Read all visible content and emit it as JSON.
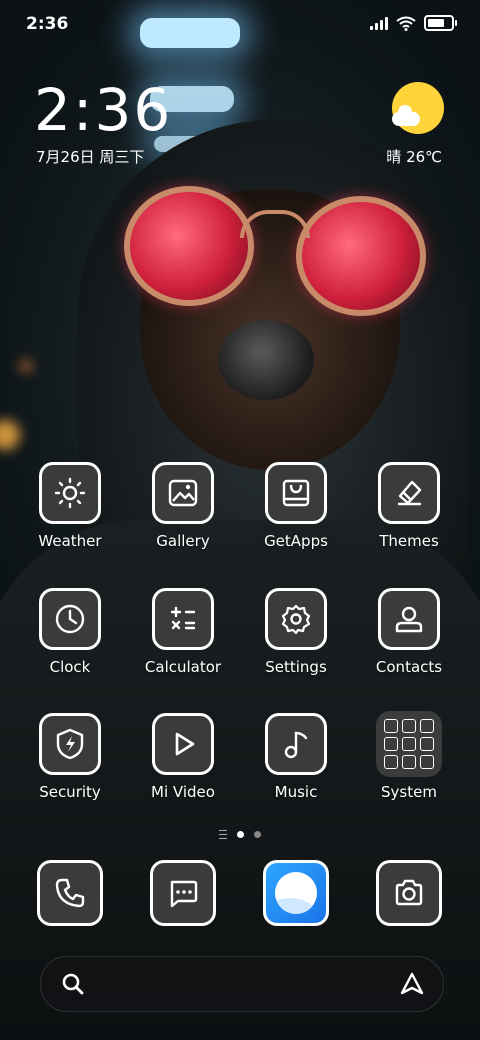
{
  "status_bar": {
    "time": "2:36",
    "battery_level": 0.9
  },
  "clock_widget": {
    "time": "2:36",
    "date": "7月26日 周三下",
    "weather": "晴 26℃"
  },
  "apps": [
    {
      "label": "Weather",
      "icon": "sun-icon"
    },
    {
      "label": "Gallery",
      "icon": "image-icon"
    },
    {
      "label": "GetApps",
      "icon": "store-icon"
    },
    {
      "label": "Themes",
      "icon": "brush-icon"
    },
    {
      "label": "Clock",
      "icon": "clock-icon"
    },
    {
      "label": "Calculator",
      "icon": "calculator-icon"
    },
    {
      "label": "Settings",
      "icon": "gear-icon"
    },
    {
      "label": "Contacts",
      "icon": "person-icon"
    },
    {
      "label": "Security",
      "icon": "shield-bolt-icon"
    },
    {
      "label": "Mi Video",
      "icon": "play-icon"
    },
    {
      "label": "Music",
      "icon": "music-note-icon"
    },
    {
      "label": "System",
      "icon": "folder-icon"
    }
  ],
  "pager": {
    "pages": 2,
    "active": 1
  },
  "dock": [
    {
      "icon": "phone-icon"
    },
    {
      "icon": "message-icon"
    },
    {
      "icon": "browser-icon"
    },
    {
      "icon": "camera-icon"
    }
  ],
  "search_bar": {
    "left_icon": "search-icon",
    "right_icon": "assistant-icon"
  },
  "colors": {
    "tile_bg": "#3a3b3d",
    "sun": "#ffd43b",
    "browser": "#1a73e8"
  }
}
